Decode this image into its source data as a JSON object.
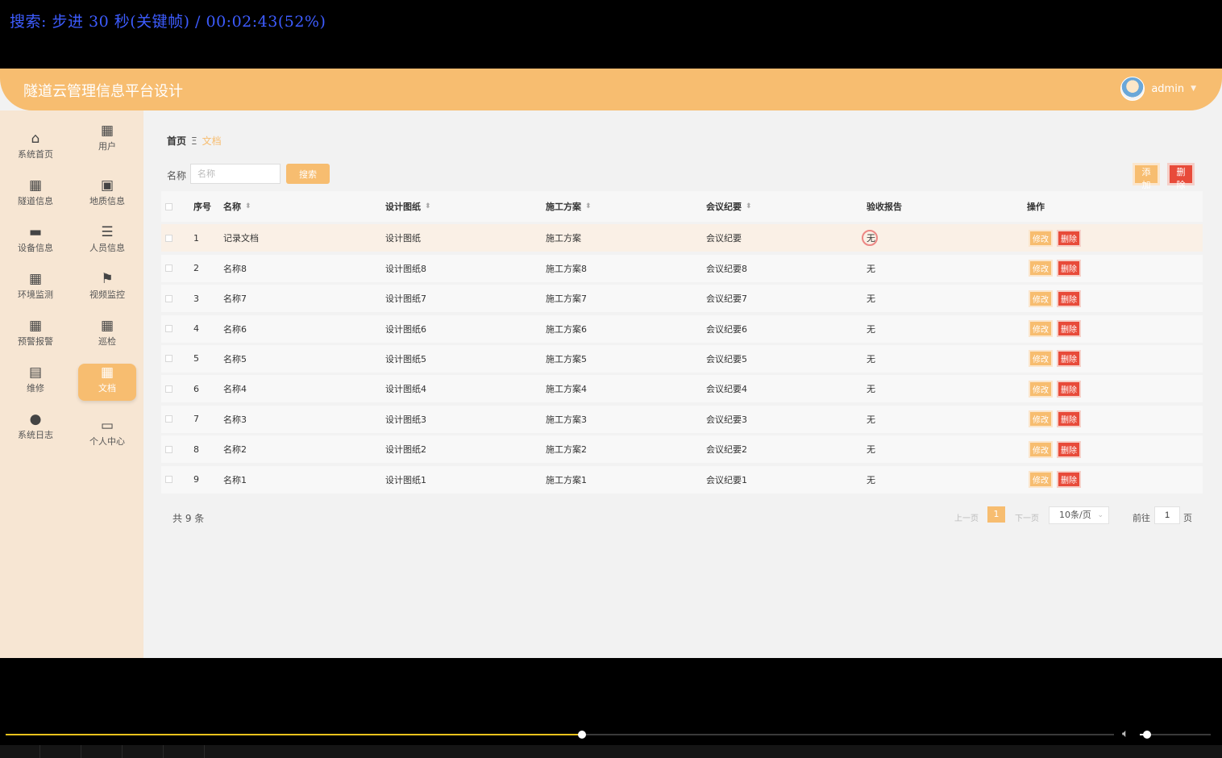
{
  "osd": {
    "text": "搜索: 步进 30 秒(关键帧) / 00:02:43(52%)"
  },
  "app": {
    "title": "隧道云管理信息平台设计"
  },
  "user": {
    "name": "admin",
    "caret": "▼"
  },
  "sidebar": {
    "items": [
      {
        "label": "系统首页",
        "icon": "home-icon",
        "glyph": "⌂"
      },
      {
        "label": "用户",
        "icon": "grid-icon",
        "glyph": "▦"
      },
      {
        "label": "隧道信息",
        "icon": "grid-icon",
        "glyph": "▦"
      },
      {
        "label": "地质信息",
        "icon": "clipboard-icon",
        "glyph": "▣"
      },
      {
        "label": "设备信息",
        "icon": "inbox-icon",
        "glyph": "▬"
      },
      {
        "label": "人员信息",
        "icon": "sliders-icon",
        "glyph": "☰"
      },
      {
        "label": "环境监测",
        "icon": "grid-icon",
        "glyph": "▦"
      },
      {
        "label": "视频监控",
        "icon": "flag-icon",
        "glyph": "⚑"
      },
      {
        "label": "预警报警",
        "icon": "grid-icon",
        "glyph": "▦"
      },
      {
        "label": "巡检",
        "icon": "grid-icon",
        "glyph": "▦"
      },
      {
        "label": "维修",
        "icon": "briefcase-icon",
        "glyph": "▤"
      },
      {
        "label": "文档",
        "icon": "grid-icon",
        "glyph": "▦"
      },
      {
        "label": "系统日志",
        "icon": "user-icon",
        "glyph": "●"
      },
      {
        "label": "个人中心",
        "icon": "card-icon",
        "glyph": "▭"
      }
    ]
  },
  "breadcrumb": {
    "home": "首页",
    "separator": "Ξ",
    "current": "文档"
  },
  "search": {
    "label": "名称",
    "placeholder": "名称",
    "button": "搜索"
  },
  "toolbar": {
    "add": "添加",
    "delete": "删除"
  },
  "table": {
    "headers": [
      "序号",
      "名称",
      "设计图纸",
      "施工方案",
      "会议纪要",
      "验收报告",
      "操作"
    ],
    "rows": [
      {
        "no": "1",
        "name": "记录文档",
        "drawing": "设计图纸",
        "plan": "施工方案",
        "minutes": "会议纪要",
        "report": "无"
      },
      {
        "no": "2",
        "name": "名称8",
        "drawing": "设计图纸8",
        "plan": "施工方案8",
        "minutes": "会议纪要8",
        "report": "无"
      },
      {
        "no": "3",
        "name": "名称7",
        "drawing": "设计图纸7",
        "plan": "施工方案7",
        "minutes": "会议纪要7",
        "report": "无"
      },
      {
        "no": "4",
        "name": "名称6",
        "drawing": "设计图纸6",
        "plan": "施工方案6",
        "minutes": "会议纪要6",
        "report": "无"
      },
      {
        "no": "5",
        "name": "名称5",
        "drawing": "设计图纸5",
        "plan": "施工方案5",
        "minutes": "会议纪要5",
        "report": "无"
      },
      {
        "no": "6",
        "name": "名称4",
        "drawing": "设计图纸4",
        "plan": "施工方案4",
        "minutes": "会议纪要4",
        "report": "无"
      },
      {
        "no": "7",
        "name": "名称3",
        "drawing": "设计图纸3",
        "plan": "施工方案3",
        "minutes": "会议纪要3",
        "report": "无"
      },
      {
        "no": "8",
        "name": "名称2",
        "drawing": "设计图纸2",
        "plan": "施工方案2",
        "minutes": "会议纪要2",
        "report": "无"
      },
      {
        "no": "9",
        "name": "名称1",
        "drawing": "设计图纸1",
        "plan": "施工方案1",
        "minutes": "会议纪要1",
        "report": "无"
      }
    ],
    "op_edit": "修改",
    "op_delete": "删除"
  },
  "pagination": {
    "total": "共 9 条",
    "prev": "上一页",
    "current_page": "1",
    "next": "下一页",
    "page_size": "10条/页",
    "goto_label": "前往",
    "goto_value": "1",
    "page_suffix": "页"
  },
  "player": {
    "progress_fraction": 0.52,
    "volume_fraction": 0.1,
    "volume_icon": "speaker-icon"
  },
  "colors": {
    "accent": "#f7bd70",
    "danger": "#e84b3a",
    "sidebar_bg": "#f7e6d3",
    "osd_text": "#3d5cff"
  }
}
